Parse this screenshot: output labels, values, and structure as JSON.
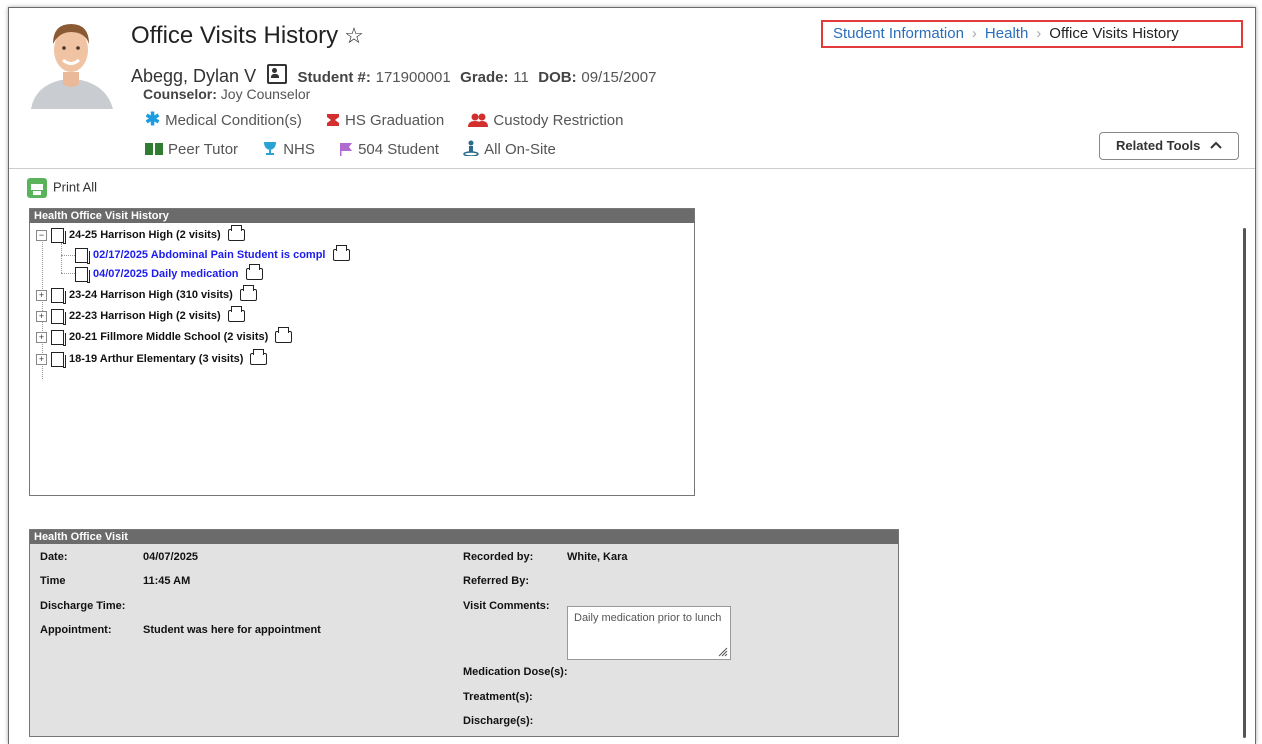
{
  "header": {
    "title": "Office Visits History",
    "student_name": "Abegg, Dylan V",
    "student_num_label": "Student #:",
    "student_num": "171900001",
    "grade_label": "Grade:",
    "grade": "11",
    "dob_label": "DOB:",
    "dob": "09/15/2007",
    "counselor_label": "Counselor:",
    "counselor": "Joy Counselor",
    "flags_row1": [
      {
        "label": "Medical Condition(s)",
        "icon": "asterisk-icon",
        "color": "#1b9be0"
      },
      {
        "label": "HS Graduation",
        "icon": "graduation-icon",
        "color": "#d32f2f"
      },
      {
        "label": "Custody Restriction",
        "icon": "people-icon",
        "color": "#d32f2f"
      }
    ],
    "flags_row2": [
      {
        "label": "Peer Tutor",
        "icon": "book-icon",
        "color": "#2e7d32"
      },
      {
        "label": "NHS",
        "icon": "trophy-icon",
        "color": "#29a3d6"
      },
      {
        "label": "504 Student",
        "icon": "flag-icon",
        "color": "#b06ad0"
      },
      {
        "label": "All On-Site",
        "icon": "person-location-icon",
        "color": "#2a6a8a"
      }
    ],
    "related_tools": "Related Tools"
  },
  "breadcrumb": {
    "items": [
      "Student Information",
      "Health",
      "Office Visits History"
    ]
  },
  "toolbar": {
    "print_all": "Print All"
  },
  "tree": {
    "header": "Health Office Visit History",
    "rows": [
      {
        "label": "24-25 Harrison High (2 visits)",
        "expanded": true
      },
      {
        "label": "02/17/2025 Abdominal Pain Student is compl",
        "child": true
      },
      {
        "label": "04/07/2025 Daily medication",
        "child": true
      },
      {
        "label": "23-24 Harrison High (310 visits)"
      },
      {
        "label": "22-23 Harrison High (2 visits)"
      },
      {
        "label": "20-21 Fillmore Middle School (2 visits)"
      },
      {
        "label": "18-19 Arthur Elementary (3 visits)"
      }
    ]
  },
  "visit": {
    "header": "Health Office Visit",
    "date_label": "Date:",
    "date": "04/07/2025",
    "time_label": "Time",
    "time": "11:45 AM",
    "discharge_time_label": "Discharge Time:",
    "appointment_label": "Appointment:",
    "appointment": "Student was here for appointment",
    "recorded_by_label": "Recorded by:",
    "recorded_by": "White, Kara",
    "referred_by_label": "Referred By:",
    "visit_comments_label": "Visit Comments:",
    "visit_comments": "Daily medication prior to lunch",
    "medication_dose_label": "Medication Dose(s):",
    "treatment_label": "Treatment(s):",
    "discharge_label": "Discharge(s):"
  }
}
